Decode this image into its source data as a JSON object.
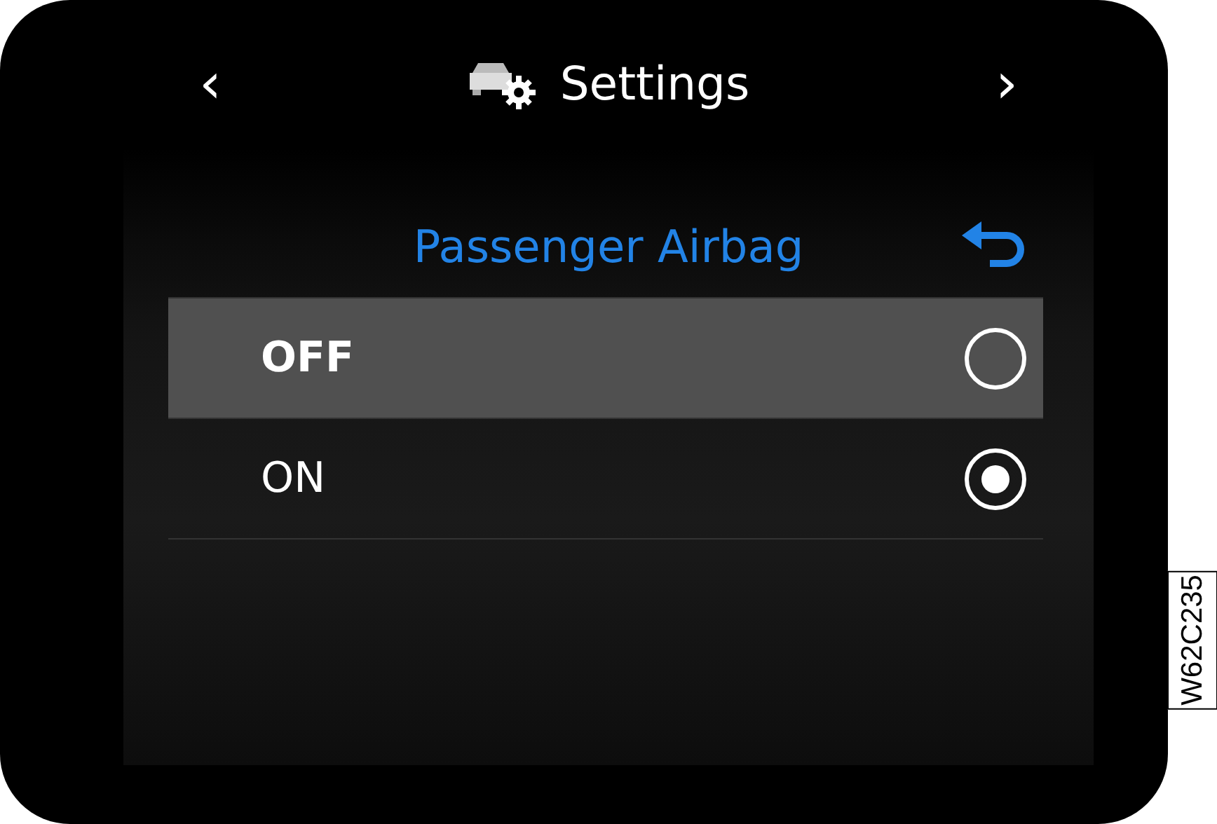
{
  "header": {
    "prev": "‹",
    "title": "Settings",
    "next": "›"
  },
  "menu": {
    "title": "Passenger Airbag",
    "options": [
      {
        "label": "OFF",
        "focused": true,
        "selected": false
      },
      {
        "label": "ON",
        "focused": false,
        "selected": true
      }
    ]
  },
  "figure_code": "W62C235"
}
